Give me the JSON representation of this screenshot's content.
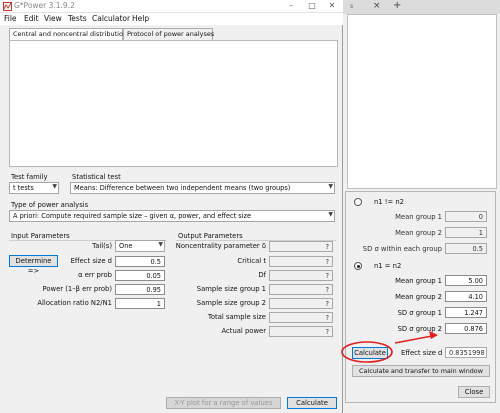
{
  "window": {
    "title": "G*Power 3.1.9.2",
    "menu": [
      "File",
      "Edit",
      "View",
      "Tests",
      "Calculator",
      "Help"
    ]
  },
  "tabs": [
    "Central and noncentral distributions",
    "Protocol of power analyses"
  ],
  "test_family": {
    "label": "Test family",
    "value": "t tests"
  },
  "statistical_test": {
    "label": "Statistical test",
    "value": "Means: Difference between two independent means (two groups)"
  },
  "power_analysis": {
    "label": "Type of power analysis",
    "value": "A priori: Compute required sample size – given α, power, and effect size"
  },
  "input_parameters": {
    "heading": "Input Parameters",
    "tails_label": "Tail(s)",
    "tails_value": "One",
    "determine_button": "Determine =>",
    "effect_label": "Effect size d",
    "effect_value": "0.5",
    "alpha_label": "α err prob",
    "alpha_value": "0.05",
    "power_label": "Power (1–β err prob)",
    "power_value": "0.95",
    "ratio_label": "Allocation ratio N2/N1",
    "ratio_value": "1"
  },
  "output_parameters": {
    "heading": "Output Parameters",
    "rows": [
      {
        "label": "Noncentrality parameter δ",
        "value": "?"
      },
      {
        "label": "Critical t",
        "value": "?"
      },
      {
        "label": "Df",
        "value": "?"
      },
      {
        "label": "Sample size group 1",
        "value": "?"
      },
      {
        "label": "Sample size group 2",
        "value": "?"
      },
      {
        "label": "Total sample size",
        "value": "?"
      },
      {
        "label": "Actual power",
        "value": "?"
      }
    ]
  },
  "buttons": {
    "xy_plot": "X-Y plot for a range of values",
    "calculate": "Calculate"
  },
  "browser_strip": {
    "tab_fragment": "s",
    "close_glyph": "×",
    "new_tab_glyph": "+"
  },
  "effect_dialog": {
    "option_unequal": "n1 != n2",
    "unequal_rows": [
      {
        "label": "Mean group 1",
        "value": "0"
      },
      {
        "label": "Mean group 2",
        "value": "1"
      },
      {
        "label": "SD σ within each group",
        "value": "0.5"
      }
    ],
    "option_equal": "n1 = n2",
    "equal_rows": [
      {
        "label": "Mean group 1",
        "value": "5.00"
      },
      {
        "label": "Mean group 2",
        "value": "4.10"
      },
      {
        "label": "SD σ group 1",
        "value": "1.247"
      },
      {
        "label": "SD σ group 2",
        "value": "0.876"
      }
    ],
    "calculate_button": "Calculate",
    "effect_label": "Effect size d",
    "effect_value": "0.8351998",
    "transfer_button": "Calculate and transfer to main window",
    "close_button": "Close"
  },
  "colors": {
    "annotation_red": "#e02020",
    "focus_blue": "#0078d7"
  }
}
